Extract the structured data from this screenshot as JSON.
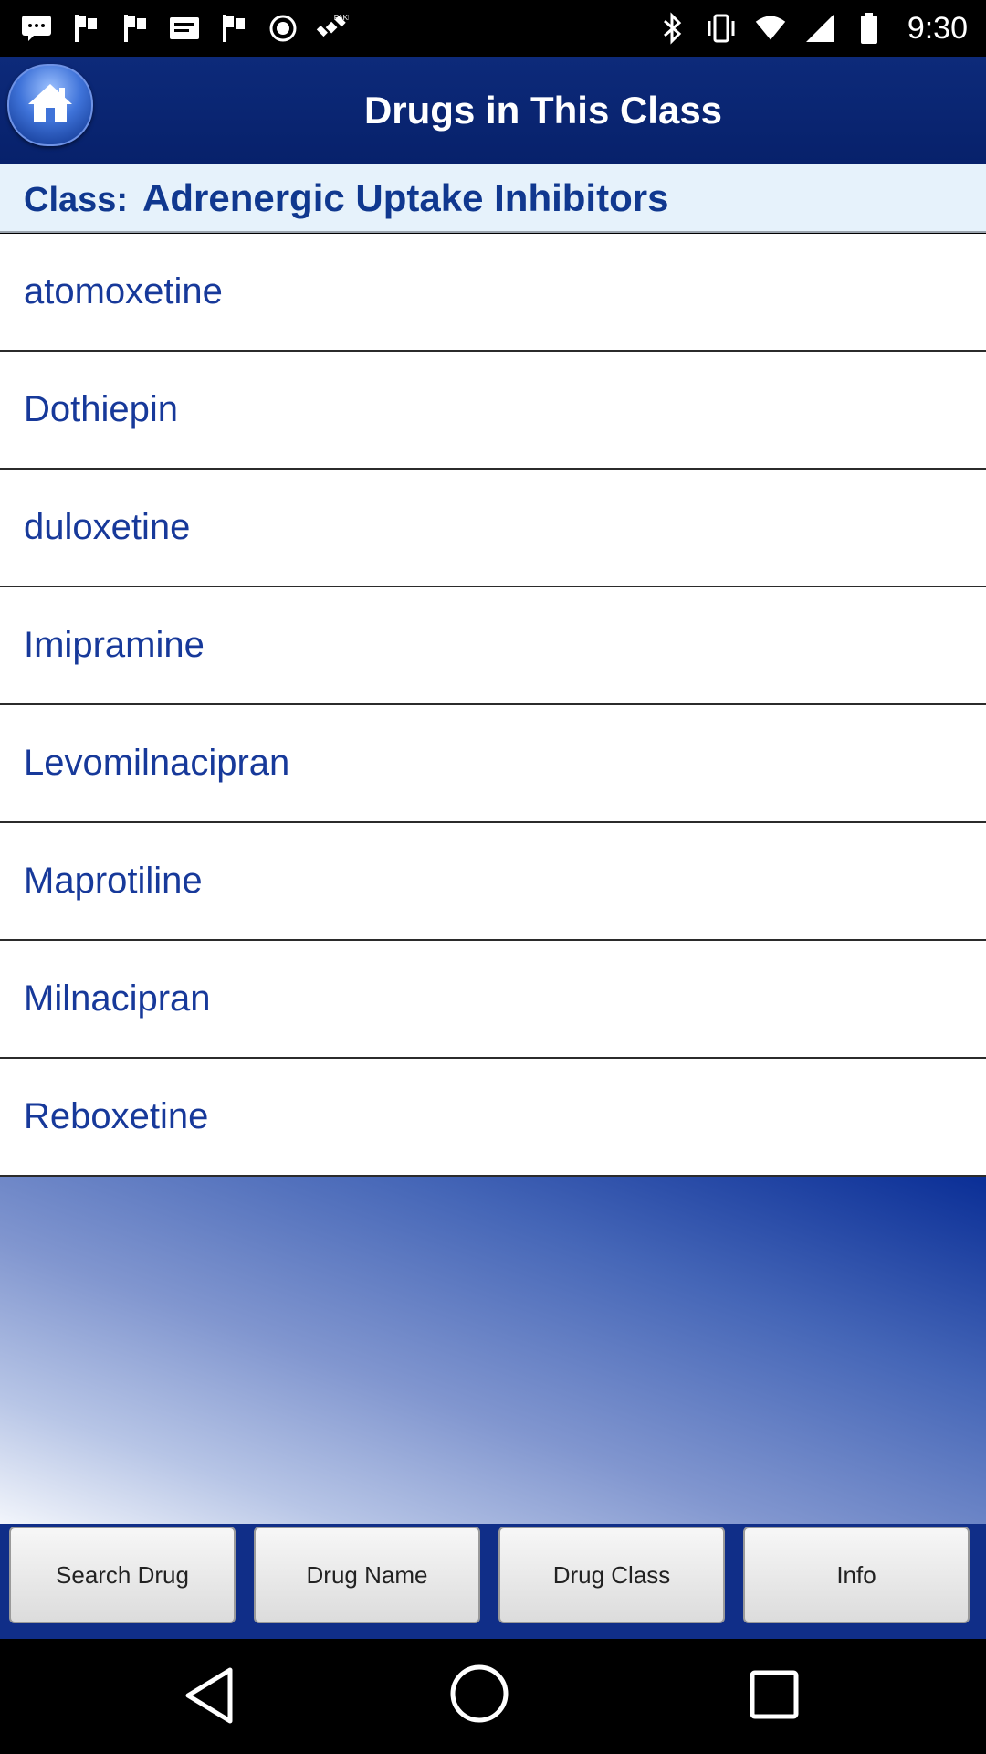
{
  "status_bar": {
    "time": "9:30",
    "left_icons": [
      "message-icon",
      "flag-icon",
      "flag-icon",
      "mail-icon",
      "flag-icon",
      "record-icon",
      "satellite-fake-gps-icon"
    ],
    "right_icons": [
      "bluetooth-icon",
      "vibrate-icon",
      "wifi-icon",
      "signal-icon",
      "battery-icon"
    ]
  },
  "header": {
    "title": "Drugs in This Class",
    "home_icon": "home-icon"
  },
  "class_row": {
    "label": "Class:",
    "name": "Adrenergic Uptake Inhibitors"
  },
  "drugs": [
    {
      "name": "atomoxetine"
    },
    {
      "name": "Dothiepin"
    },
    {
      "name": "duloxetine"
    },
    {
      "name": "Imipramine"
    },
    {
      "name": "Levomilnacipran"
    },
    {
      "name": "Maprotiline"
    },
    {
      "name": "Milnacipran"
    },
    {
      "name": "Reboxetine"
    }
  ],
  "tabs": [
    {
      "label": "Search Drug"
    },
    {
      "label": "Drug Name"
    },
    {
      "label": "Drug Class"
    },
    {
      "label": "Info"
    }
  ],
  "colors": {
    "header_bg": "#0d2a7a",
    "accent_text": "#17399a",
    "class_row_bg": "#e6f2fb"
  },
  "nav_bar": [
    "back-icon",
    "home-circle-icon",
    "recents-icon"
  ]
}
